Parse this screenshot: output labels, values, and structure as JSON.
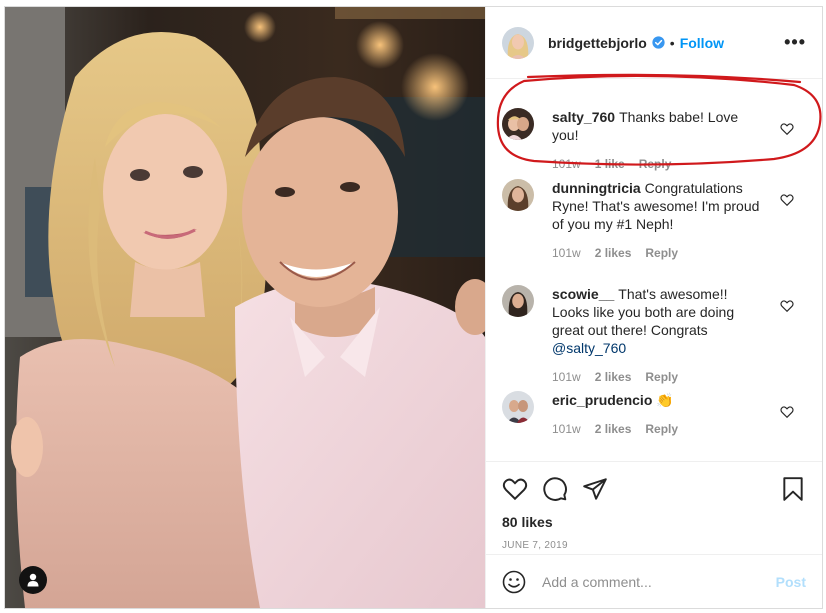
{
  "post": {
    "author": "bridgettebjorlo",
    "separator": "•",
    "follow_label": "Follow",
    "more_label": "•••",
    "likes_label": "80 likes",
    "date": "JUNE 7, 2019"
  },
  "comments": [
    {
      "username": "salty_760",
      "text": "Thanks babe! Love you!",
      "age": "101w",
      "likes": "1 like",
      "reply": "Reply",
      "mention": "",
      "emoji": ""
    },
    {
      "username": "dunningtricia",
      "text": "Congratulations Ryne! That's awesome! I'm proud of you my #1 Neph!",
      "age": "101w",
      "likes": "2 likes",
      "reply": "Reply",
      "mention": "",
      "emoji": ""
    },
    {
      "username": "scowie__",
      "text": "That's awesome!! Looks like you both are doing great out there! Congrats",
      "mention": "@salty_760",
      "age": "101w",
      "likes": "2 likes",
      "reply": "Reply",
      "emoji": ""
    },
    {
      "username": "eric_prudencio",
      "text": "",
      "emoji": "👏",
      "age": "101w",
      "likes": "2 likes",
      "reply": "Reply",
      "mention": ""
    }
  ],
  "composer": {
    "placeholder": "Add a comment...",
    "post_label": "Post"
  },
  "icons": {
    "tag": "user-tag-icon",
    "verified": "verified-badge-icon",
    "like": "heart-icon",
    "comment": "comment-icon",
    "share": "share-icon",
    "save": "bookmark-icon",
    "emoji": "emoji-icon"
  },
  "colors": {
    "follow": "#0095f6",
    "annotation": "#d0191c",
    "post_disabled": "#b2dffc",
    "secondary_text": "#8e8e8e"
  }
}
